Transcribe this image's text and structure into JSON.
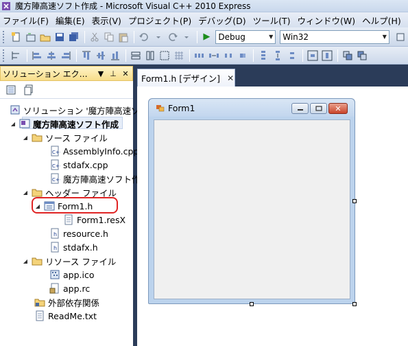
{
  "window": {
    "title": "魔方陣高速ソフト作成 - Microsoft Visual C++ 2010 Express"
  },
  "menu": [
    "ファイル(F)",
    "編集(E)",
    "表示(V)",
    "プロジェクト(P)",
    "デバッグ(D)",
    "ツール(T)",
    "ウィンドウ(W)",
    "ヘルプ(H)"
  ],
  "toolbar": {
    "config": "Debug",
    "platform": "Win32"
  },
  "solution_explorer": {
    "title": "ソリューション エク…",
    "solution": "ソリューション '魔方陣高速ソ",
    "project": "魔方陣高速ソフト作成",
    "source_folder": "ソース ファイル",
    "sources": [
      "AssemblyInfo.cpp",
      "stdafx.cpp",
      "魔方陣高速ソフト作"
    ],
    "header_folder": "ヘッダー ファイル",
    "form_h": "Form1.h",
    "form_resx": "Form1.resX",
    "headers": [
      "resource.h",
      "stdafx.h"
    ],
    "resource_folder": "リソース ファイル",
    "resources": [
      "app.ico",
      "app.rc"
    ],
    "external": "外部依存関係",
    "readme": "ReadMe.txt"
  },
  "editor": {
    "tab_label": "Form1.h [デザイン]",
    "form_title": "Form1"
  }
}
